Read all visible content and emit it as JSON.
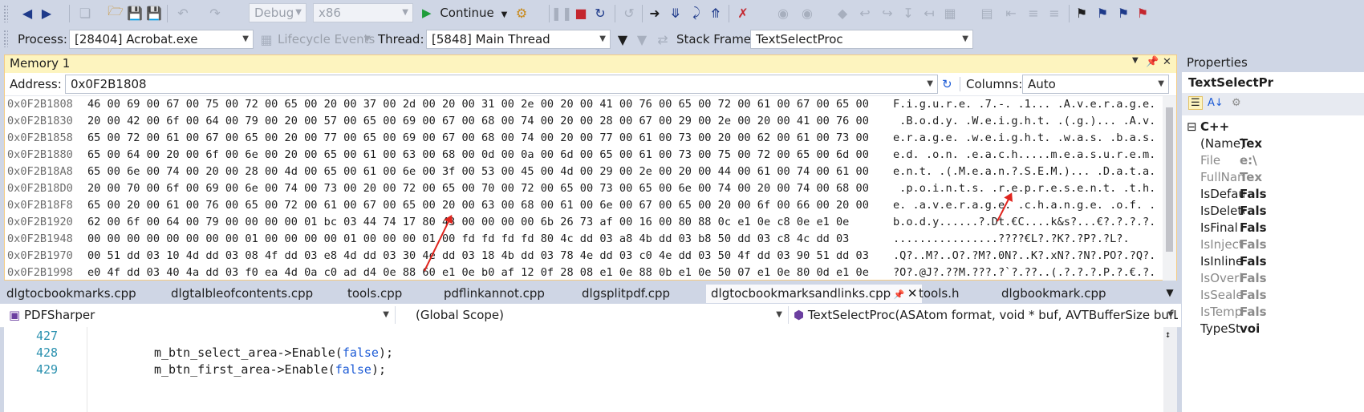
{
  "toolbar": {
    "config_value": "Debug",
    "platform_value": "x86",
    "continue_label": "Continue",
    "process_label": "Process:",
    "process_value": "[28404] Acrobat.exe",
    "lifecycle_label": "Lifecycle Events",
    "thread_label": "Thread:",
    "thread_value": "[5848] Main Thread",
    "stackframe_label": "Stack Frame:",
    "stackframe_value": "TextSelectProc"
  },
  "memory": {
    "title": "Memory 1",
    "address_label": "Address:",
    "address_value": "0x0F2B1808",
    "columns_label": "Columns:",
    "columns_value": "Auto",
    "rows": [
      {
        "addr": "0x0F2B1808",
        "bytes": "46 00 69 00 67 00 75 00 72 00 65 00 20 00 37 00 2d 00 20 00 31 00 2e 00 20 00 41 00 76 00 65 00 72 00 61 00 67 00 65 00",
        "ascii": "F.i.g.u.r.e. .7.-. .1... .A.v.e.r.a.g.e."
      },
      {
        "addr": "0x0F2B1830",
        "bytes": "20 00 42 00 6f 00 64 00 79 00 20 00 57 00 65 00 69 00 67 00 68 00 74 00 20 00 28 00 67 00 29 00 2e 00 20 00 41 00 76 00",
        "ascii": " .B.o.d.y. .W.e.i.g.h.t. .(.g.)... .A.v."
      },
      {
        "addr": "0x0F2B1858",
        "bytes": "65 00 72 00 61 00 67 00 65 00 20 00 77 00 65 00 69 00 67 00 68 00 74 00 20 00 77 00 61 00 73 00 20 00 62 00 61 00 73 00",
        "ascii": "e.r.a.g.e. .w.e.i.g.h.t. .w.a.s. .b.a.s."
      },
      {
        "addr": "0x0F2B1880",
        "bytes": "65 00 64 00 20 00 6f 00 6e 00 20 00 65 00 61 00 63 00 68 00 0d 00 0a 00 6d 00 65 00 61 00 73 00 75 00 72 00 65 00 6d 00",
        "ascii": "e.d. .o.n. .e.a.c.h.....m.e.a.s.u.r.e.m."
      },
      {
        "addr": "0x0F2B18A8",
        "bytes": "65 00 6e 00 74 00 20 00 28 00 4d 00 65 00 61 00 6e 00 3f 00 53 00 45 00 4d 00 29 00 2e 00 20 00 44 00 61 00 74 00 61 00",
        "ascii": "e.n.t. .(.M.e.a.n.?.S.E.M.)... .D.a.t.a."
      },
      {
        "addr": "0x0F2B18D0",
        "bytes": "20 00 70 00 6f 00 69 00 6e 00 74 00 73 00 20 00 72 00 65 00 70 00 72 00 65 00 73 00 65 00 6e 00 74 00 20 00 74 00 68 00",
        "ascii": " .p.o.i.n.t.s. .r.e.p.r.e.s.e.n.t. .t.h."
      },
      {
        "addr": "0x0F2B18F8",
        "bytes": "65 00 20 00 61 00 76 00 65 00 72 00 61 00 67 00 65 00 20 00 63 00 68 00 61 00 6e 00 67 00 65 00 20 00 6f 00 66 00 20 00",
        "ascii": "e. .a.v.e.r.a.g.e. .c.h.a.n.g.e. .o.f. ."
      },
      {
        "addr": "0x0F2B1920",
        "bytes": "62 00 6f 00 64 00 79 00 00 00 00 01 bc 03 44 74 17 80 43 00 00 00 00 6b 26 73 af 00 16 00 80 88 0c e1 0e c8 0e e1 0e",
        "ascii": "b.o.d.y......?.Dt.€C....k&s?...€?.?.?.?."
      },
      {
        "addr": "0x0F2B1948",
        "bytes": "00 00 00 00 00 00 00 00 01 00 00 00 00 01 00 00 00 01 00 fd fd fd fd 80 4c dd 03 a8 4b dd 03 b8 50 dd 03 c8 4c dd 03",
        "ascii": "................????€L?.?K?.?P?.?L?."
      },
      {
        "addr": "0x0F2B1970",
        "bytes": "00 51 dd 03 10 4d dd 03 08 4f dd 03 e8 4d dd 03 30 4e dd 03 18 4b dd 03 78 4e dd 03 c0 4e dd 03 50 4f dd 03 90 51 dd 03",
        "ascii": ".Q?..M?..O?.?M?.0N?..K?.xN?.?N?.PO?.?Q?."
      },
      {
        "addr": "0x0F2B1998",
        "bytes": "e0 4f dd 03 40 4a dd 03 f0 ea 4d 0a c0 ad d4 0e 88 60 e1 0e b0 af 12 0f 28 08 e1 0e 88 0b e1 0e 50 07 e1 0e 80 0d e1 0e",
        "ascii": "?O?.@J?.??M.???.?`?.??..(.?.?.?.P.?.€.?."
      },
      {
        "addr": "0x0F2B19C0",
        "bytes": "30 06 e1 0e 98 07 e1 0e 78 06 e1 0e 70 08 e1 0e 98 07 e1 0e c0 06 e1 0e d0 0b e1 0e a0 0e e1 0e a8 0c e1 0e 48 08 e1 0e",
        "ascii": "0.?.?.?.x.?.p.?.?.?.?.?.?.?.?.?.?.?.H.?."
      }
    ]
  },
  "tabs": [
    "dlgtocbookmarks.cpp",
    "dlgtalbleofcontents.cpp",
    "tools.cpp",
    "pdflinkannot.cpp",
    "dlgsplitpdf.cpp",
    "dlgtocbookmarksandlinks.cpp",
    "tools.h",
    "dlgbookmark.cpp"
  ],
  "navbar": {
    "project": "PDFSharper",
    "scope": "(Global Scope)",
    "function": "TextSelectProc(ASAtom format, void * buf, AVTBufferSize bufLen, v"
  },
  "code": {
    "lines": [
      {
        "num": "427",
        "pre": "",
        "kw": "",
        "post": ""
      },
      {
        "num": "428",
        "pre": "m_btn_select_area->Enable(",
        "kw": "false",
        "post": ");"
      },
      {
        "num": "429",
        "pre": "m_btn_first_area->Enable(",
        "kw": "false",
        "post": ");"
      }
    ]
  },
  "properties": {
    "title": "Properties",
    "object": "TextSelectPr",
    "category": "C++",
    "rows": [
      {
        "key": "(Name)",
        "value": "Tex",
        "dim": false
      },
      {
        "key": "File",
        "value": "e:\\",
        "dim": true
      },
      {
        "key": "FullName",
        "value": "Tex",
        "dim": true
      },
      {
        "key": "IsDefault",
        "value": "Fals",
        "dim": false
      },
      {
        "key": "IsDelete",
        "value": "Fals",
        "dim": false
      },
      {
        "key": "IsFinal",
        "value": "Fals",
        "dim": false
      },
      {
        "key": "IsInject",
        "value": "Fals",
        "dim": true
      },
      {
        "key": "IsInline",
        "value": "Fals",
        "dim": false
      },
      {
        "key": "IsOverl",
        "value": "Fals",
        "dim": true
      },
      {
        "key": "IsSeale",
        "value": "Fals",
        "dim": true
      },
      {
        "key": "IsTemp",
        "value": "Fals",
        "dim": true
      },
      {
        "key": "TypeSt",
        "value": "voi",
        "dim": false
      }
    ]
  },
  "colors": {
    "accent": "#FDF4BF",
    "chrome": "#CFD6E5",
    "annotation": "#E0261F",
    "keyword": "#1E5CD6"
  }
}
